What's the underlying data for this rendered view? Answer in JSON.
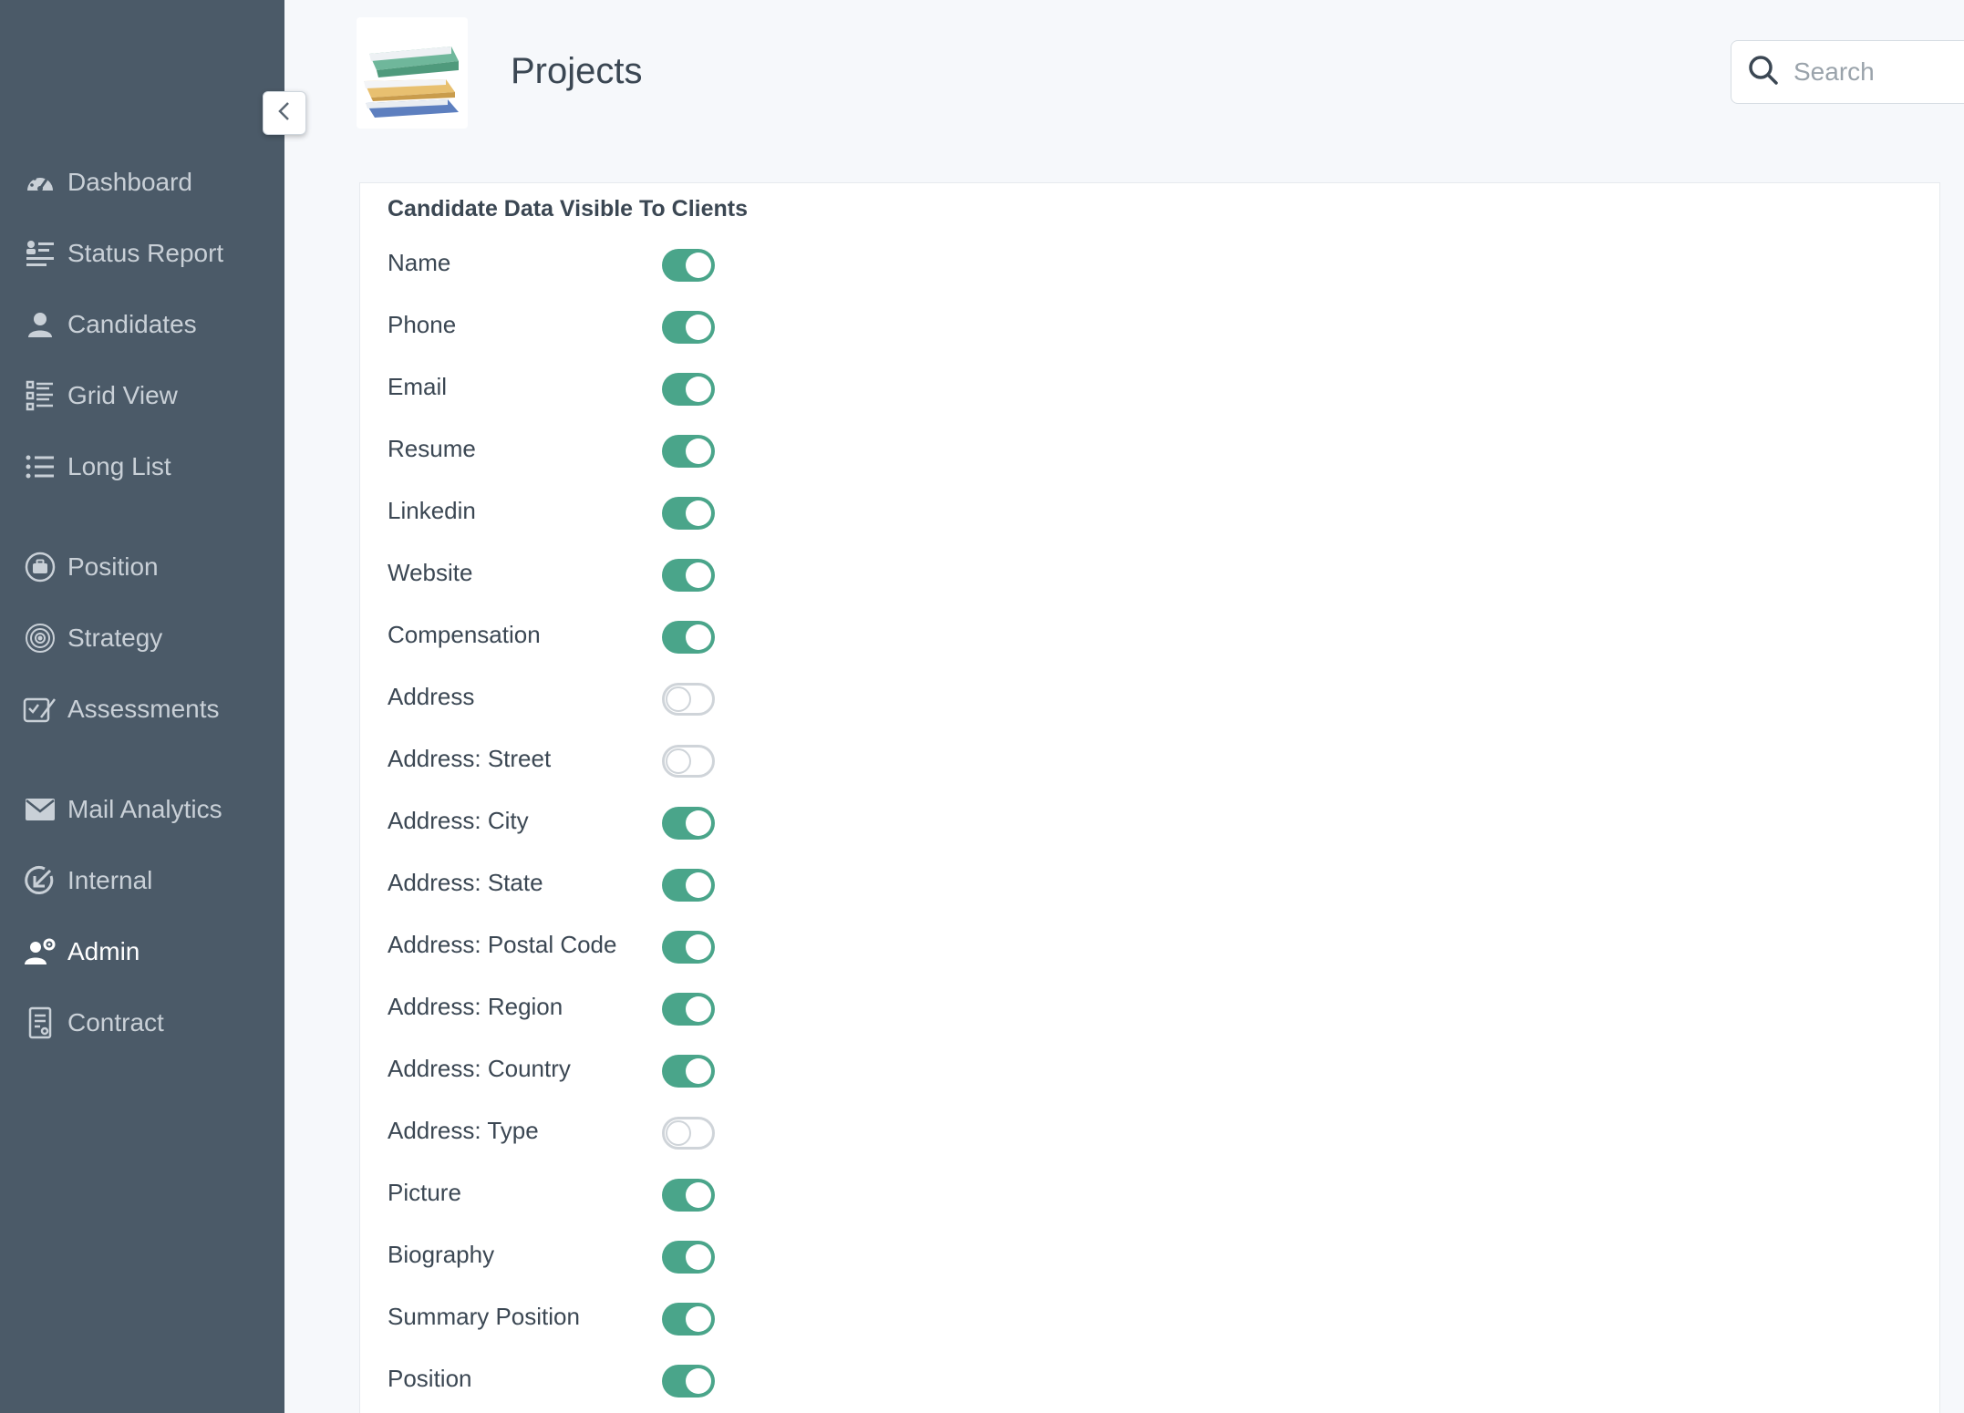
{
  "app": {
    "title": "Projects",
    "search_placeholder": "Search"
  },
  "sidebar": {
    "items": [
      {
        "label": "Dashboard",
        "icon": "dashboard-gauge-icon"
      },
      {
        "label": "Status Report",
        "icon": "status-report-icon"
      },
      {
        "label": "Candidates",
        "icon": "user-icon"
      },
      {
        "label": "Grid View",
        "icon": "grid-list-icon"
      },
      {
        "label": "Long List",
        "icon": "list-icon"
      },
      {
        "label": "Position",
        "icon": "briefcase-icon"
      },
      {
        "label": "Strategy",
        "icon": "target-icon"
      },
      {
        "label": "Assessments",
        "icon": "assessment-icon"
      },
      {
        "label": "Mail Analytics",
        "icon": "mail-icon"
      },
      {
        "label": "Internal",
        "icon": "internal-arrow-icon"
      },
      {
        "label": "Admin",
        "icon": "admin-user-gear-icon",
        "active": true
      },
      {
        "label": "Contract",
        "icon": "contract-document-icon"
      }
    ]
  },
  "panel": {
    "title": "Candidate Data Visible To Clients",
    "fields": [
      {
        "label": "Name",
        "enabled": true
      },
      {
        "label": "Phone",
        "enabled": true
      },
      {
        "label": "Email",
        "enabled": true
      },
      {
        "label": "Resume",
        "enabled": true
      },
      {
        "label": "Linkedin",
        "enabled": true
      },
      {
        "label": "Website",
        "enabled": true
      },
      {
        "label": "Compensation",
        "enabled": true
      },
      {
        "label": "Address",
        "enabled": false
      },
      {
        "label": "Address: Street",
        "enabled": false
      },
      {
        "label": "Address: City",
        "enabled": true
      },
      {
        "label": "Address: State",
        "enabled": true
      },
      {
        "label": "Address: Postal Code",
        "enabled": true
      },
      {
        "label": "Address: Region",
        "enabled": true
      },
      {
        "label": "Address: Country",
        "enabled": true
      },
      {
        "label": "Address: Type",
        "enabled": false
      },
      {
        "label": "Picture",
        "enabled": true
      },
      {
        "label": "Biography",
        "enabled": true
      },
      {
        "label": "Summary Position",
        "enabled": true
      },
      {
        "label": "Position",
        "enabled": true
      }
    ]
  },
  "colors": {
    "sidebar_bg": "#4b5a68",
    "toggle_on": "#4aa58a",
    "toggle_off_border": "#cfd4d9"
  }
}
